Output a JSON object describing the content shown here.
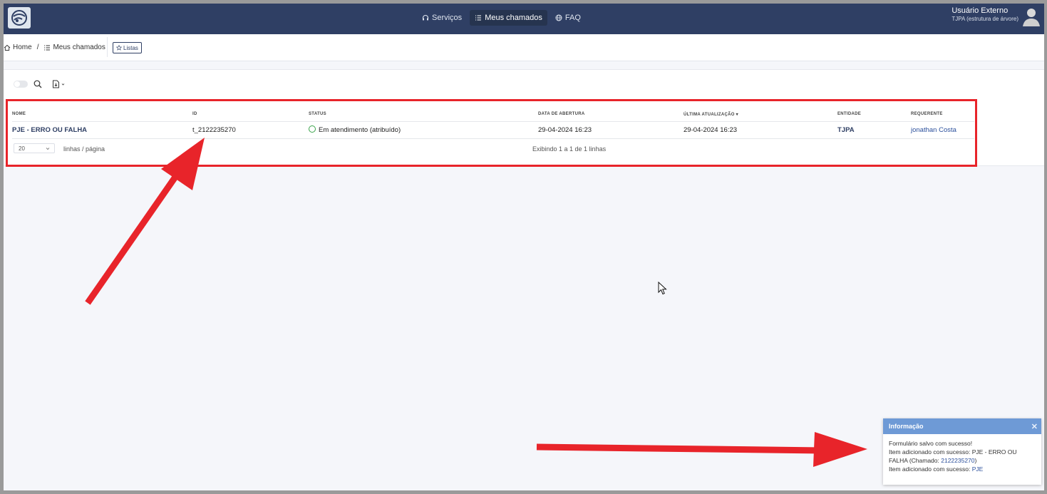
{
  "navbar": {
    "items": [
      {
        "label": "Serviços",
        "icon": "headset-icon"
      },
      {
        "label": "Meus chamados",
        "icon": "list-icon",
        "active": true
      },
      {
        "label": "FAQ",
        "icon": "globe-icon"
      }
    ],
    "user": {
      "name": "Usuário Externo",
      "entity": "TJPA (estrutura de árvore)"
    }
  },
  "breadcrumb": {
    "home": "Home",
    "separator": "/",
    "current": "Meus chamados",
    "lists_button": "Listas"
  },
  "table": {
    "headers": [
      "NOME",
      "ID",
      "STATUS",
      "DATA DE ABERTURA",
      "ÚLTIMA ATUALIZAÇÃO ▾",
      "ENTIDADE",
      "REQUERENTE"
    ],
    "rows": [
      {
        "name": "PJE - ERRO OU FALHA",
        "id": "t_2122235270",
        "status": "Em atendimento (atribuído)",
        "opened": "29-04-2024 16:23",
        "updated": "29-04-2024 16:23",
        "entity": "TJPA",
        "requester": "jonathan Costa"
      }
    ],
    "page_size": "20",
    "page_size_label": "linhas / página",
    "showing": "Exibindo 1 a 1 de 1 linhas"
  },
  "toast": {
    "title": "Informação",
    "line1": "Formulário salvo com sucesso!",
    "line2_prefix": "Item adicionado com sucesso: PJE - ERRO OU FALHA (Chamado: ",
    "line2_link": "2122235270",
    "line2_suffix": ")",
    "line3_prefix": "Item adicionado com sucesso: ",
    "line3_link": "PJE"
  },
  "colors": {
    "navbar": "#2f3f64",
    "annotation_red": "#e8242a",
    "toast_header": "#6e9ad6",
    "status_green": "#39a34a"
  }
}
